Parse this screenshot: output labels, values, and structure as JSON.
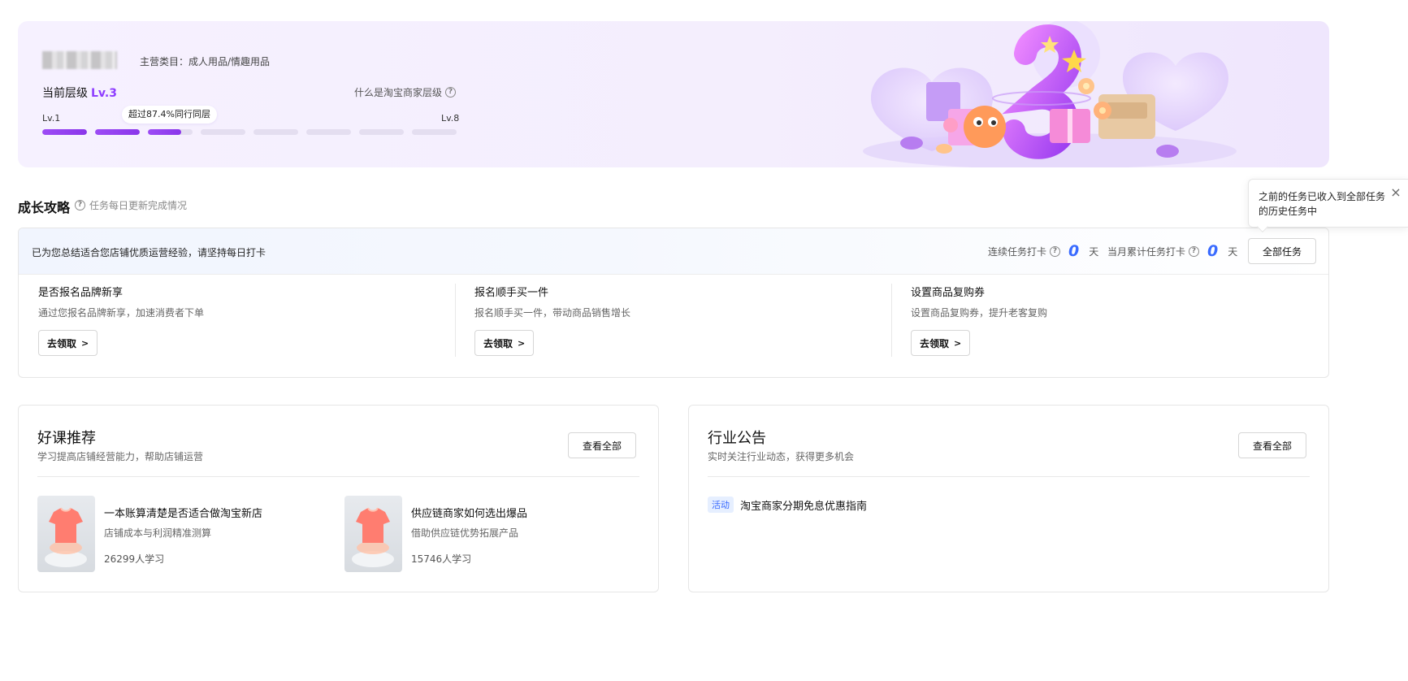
{
  "level_banner": {
    "category": "主营类目：成人用品/情趣用品",
    "current_level_label": "当前层级",
    "current_level": "Lv.3",
    "what_is_level": "什么是淘宝商家层级",
    "min_level": "Lv.1",
    "max_level": "Lv.8",
    "progress_tip": "超过87.4%同行同层",
    "segment_fill": [
      1,
      1,
      0.75,
      0,
      0,
      0,
      0,
      0
    ],
    "accent_color": "#8e3dff"
  },
  "growth": {
    "title": "成长攻略",
    "hint": "任务每日更新完成情况",
    "intro": "已为您总结适合您店铺优质运营经验，请坚持每日打卡",
    "streak_label": "连续任务打卡",
    "streak_value": "0",
    "streak_unit": "天",
    "monthly_label": "当月累计任务打卡",
    "monthly_value": "0",
    "monthly_unit": "天",
    "all_tasks_label": "全部任务",
    "tasks": [
      {
        "title": "是否报名品牌新享",
        "desc": "通过您报名品牌新享，加速消费者下单",
        "button": "去领取"
      },
      {
        "title": "报名顺手买一件",
        "desc": "报名顺手买一件，带动商品销售增长",
        "button": "去领取"
      },
      {
        "title": "设置商品复购券",
        "desc": "设置商品复购券，提升老客复购",
        "button": "去领取"
      }
    ]
  },
  "popover": {
    "text": "之前的任务已收入到全部任务的历史任务中",
    "close_icon": "close-icon"
  },
  "courses": {
    "title": "好课推荐",
    "subtitle": "学习提高店铺经营能力，帮助店铺运营",
    "view_all": "查看全部",
    "items": [
      {
        "title": "一本账算清楚是否适合做淘宝新店",
        "desc": "店铺成本与利润精准测算",
        "count": "26299人学习"
      },
      {
        "title": "供应链商家如何选出爆品",
        "desc": "借助供应链优势拓展产品",
        "count": "15746人学习"
      }
    ]
  },
  "announcements": {
    "title": "行业公告",
    "subtitle": "实时关注行业动态，获得更多机会",
    "view_all": "查看全部",
    "items": [
      {
        "tag": "活动",
        "text": "淘宝商家分期免息优惠指南"
      }
    ]
  }
}
